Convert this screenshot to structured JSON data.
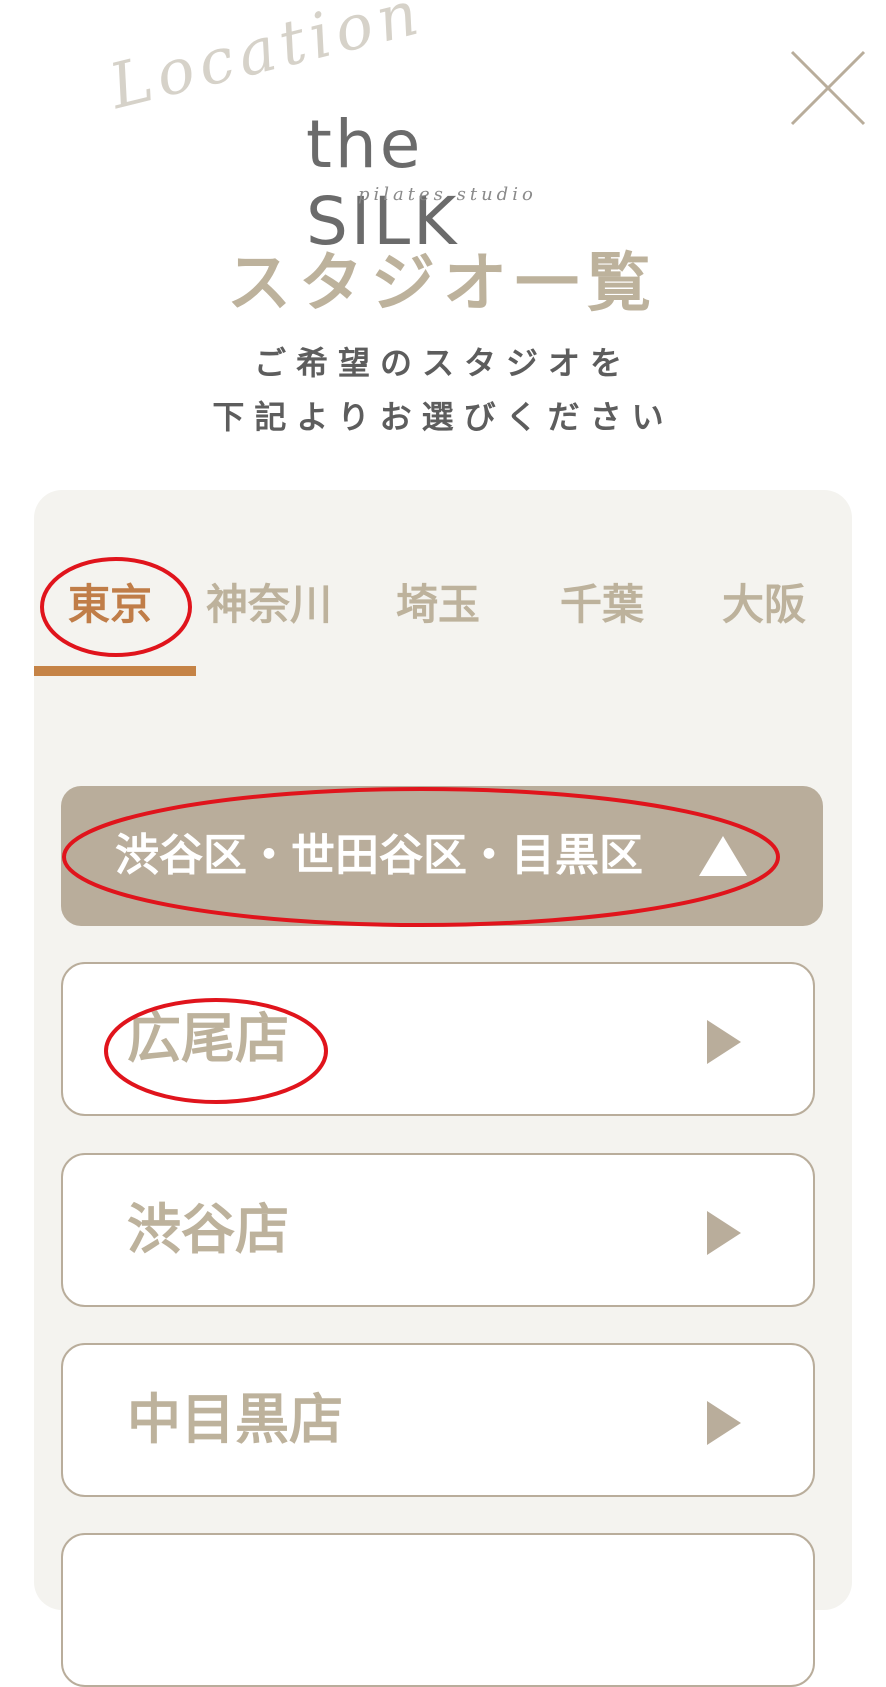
{
  "logo": {
    "script_text": "Location",
    "brand": "the SILK",
    "tagline": "pilates studio"
  },
  "close": {
    "icon": "close-icon"
  },
  "page": {
    "title": "スタジオ一覧",
    "subtitle_line1": "ご希望のスタジオを",
    "subtitle_line2": "下記よりお選びください"
  },
  "tabs": [
    {
      "label": "東京",
      "active": true
    },
    {
      "label": "神奈川",
      "active": false
    },
    {
      "label": "埼玉",
      "active": false
    },
    {
      "label": "千葉",
      "active": false
    },
    {
      "label": "大阪",
      "active": false
    }
  ],
  "area": {
    "label": "渋谷区・世田谷区・目黒区",
    "expanded": true,
    "icon": "caret-up-icon"
  },
  "stores": [
    {
      "label": "広尾店",
      "icon": "play-arrow-icon"
    },
    {
      "label": "渋谷店",
      "icon": "play-arrow-icon"
    },
    {
      "label": "中目黒店",
      "icon": "play-arrow-icon"
    }
  ],
  "colors": {
    "accent": "#c58346",
    "beige": "#bdb29c",
    "header_bg": "#b9ad9b",
    "panel_bg": "#f4f3ef",
    "annotation": "#e0141c"
  }
}
